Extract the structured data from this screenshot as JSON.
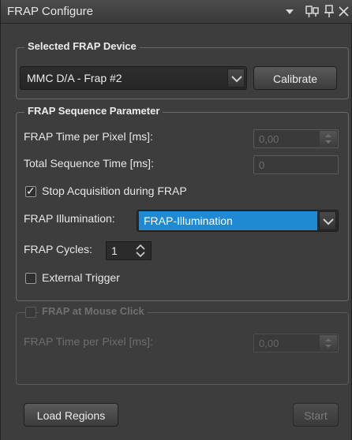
{
  "window": {
    "title": "FRAP Configure"
  },
  "device_group": {
    "legend": "Selected FRAP Device",
    "device_value": "MMC D/A - Frap #2",
    "calibrate_label": "Calibrate"
  },
  "sequence_group": {
    "legend": "FRAP Sequence Parameter",
    "time_per_pixel_label": "FRAP Time per Pixel  [ms]:",
    "time_per_pixel_value": "0,00",
    "total_time_label": "Total Sequence Time  [ms]:",
    "total_time_value": "0",
    "stop_acq_label": "Stop Acquisition during FRAP",
    "stop_acq_checked": true,
    "illumination_label": "FRAP Illumination:",
    "illumination_value": "FRAP-Illumination",
    "cycles_label": "FRAP Cycles:",
    "cycles_value": "1",
    "external_trigger_label": "External Trigger",
    "external_trigger_checked": false
  },
  "mouse_group": {
    "legend": "FRAP at Mouse Click",
    "time_per_pixel_label": "FRAP Time per Pixel  [ms]:",
    "time_per_pixel_value": "0,00"
  },
  "footer": {
    "load_regions_label": "Load Regions",
    "start_label": "Start"
  },
  "icons": [
    "dropdown-arrow-icon",
    "float-window-icon",
    "pin-icon",
    "close-icon",
    "chevron-down-icon",
    "spinner-icon",
    "checkmark-icon"
  ]
}
